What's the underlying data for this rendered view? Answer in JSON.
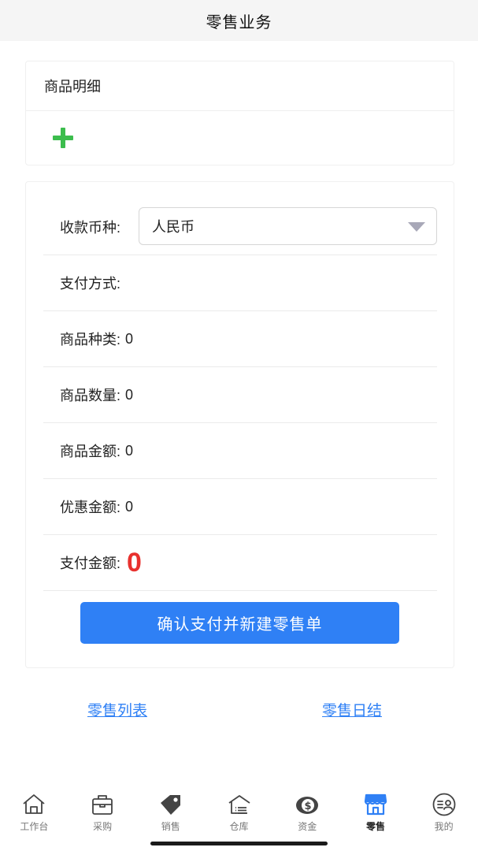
{
  "header": {
    "title": "零售业务"
  },
  "detail": {
    "title": "商品明细"
  },
  "payment": {
    "currency_label": "收款币种:",
    "currency_value": "人民币",
    "method_label": "支付方式:",
    "method_value": "",
    "kinds_label": "商品种类:",
    "kinds_value": "0",
    "qty_label": "商品数量:",
    "qty_value": "0",
    "amount_label": "商品金额:",
    "amount_value": "0",
    "discount_label": "优惠金额:",
    "discount_value": "0",
    "pay_label": "支付金额:",
    "pay_value": "0",
    "confirm_label": "确认支付并新建零售单"
  },
  "links": {
    "list": "零售列表",
    "daily": "零售日结"
  },
  "tabbar": {
    "items": [
      {
        "label": "工作台",
        "icon": "home-icon"
      },
      {
        "label": "采购",
        "icon": "bag-icon"
      },
      {
        "label": "销售",
        "icon": "tag-icon"
      },
      {
        "label": "仓库",
        "icon": "warehouse-icon"
      },
      {
        "label": "资金",
        "icon": "money-icon"
      },
      {
        "label": "零售",
        "icon": "store-icon"
      },
      {
        "label": "我的",
        "icon": "profile-icon"
      }
    ],
    "active_index": 5
  },
  "colors": {
    "accent": "#2f80f5",
    "plus": "#3cbd4d",
    "pay_amount": "#e8312e"
  }
}
